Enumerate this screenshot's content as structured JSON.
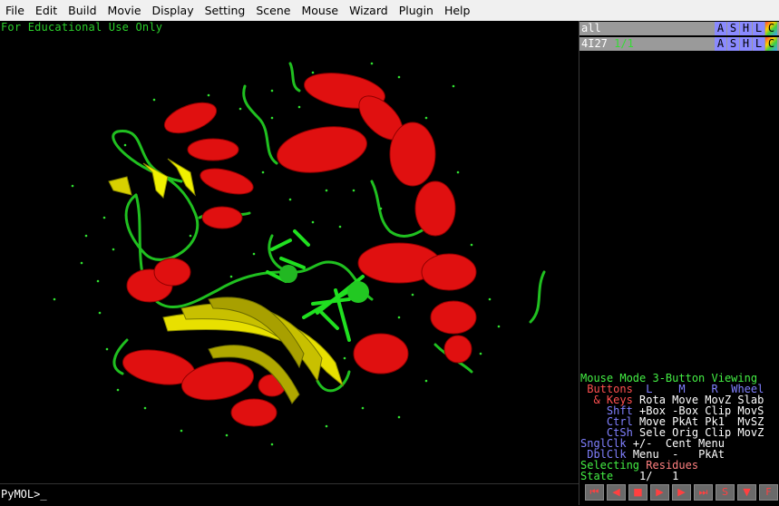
{
  "menu": [
    "File",
    "Edit",
    "Build",
    "Movie",
    "Display",
    "Setting",
    "Scene",
    "Mouse",
    "Wizard",
    "Plugin",
    "Help"
  ],
  "viewer": {
    "watermark": "For Educational Use Only"
  },
  "objects": [
    {
      "name": "all",
      "state": "",
      "buttons": [
        "A",
        "S",
        "H",
        "L",
        "C"
      ]
    },
    {
      "name": "4I27",
      "state": "1/1",
      "buttons": [
        "A",
        "S",
        "H",
        "L",
        "C"
      ]
    }
  ],
  "mouse": {
    "mode_label": "Mouse Mode",
    "mode_value": "3-Button Viewing",
    "buttons_label": "Buttons",
    "col_l": "L",
    "col_m": "M",
    "col_r": "R",
    "col_wheel": "Wheel",
    "keys_label": "& Keys",
    "keys_row": "Rota Move MovZ Slab",
    "shft_label": "Shft",
    "shft_row": "+Box -Box Clip MovS",
    "ctrl_label": "Ctrl",
    "ctrl_row": "Move PkAt Pk1  MvSZ",
    "ctsh_label": "CtSh",
    "ctsh_row": "Sele Orig Clip MovZ",
    "snglclk_label": "SnglClk",
    "snglclk_row": "+/-  Cent Menu",
    "dblclk_label": "DblClk",
    "dblclk_row": "Menu  -   PkAt",
    "selecting_label": "Selecting",
    "selecting_value": "Residues",
    "state_label": "State",
    "state_value": "1/   1"
  },
  "command": {
    "prompt": "PyMOL>_"
  },
  "movie_controls": [
    "rewind-icon",
    "step-back-icon",
    "stop-icon",
    "play-icon",
    "step-forward-icon",
    "end-icon",
    "S",
    "menu-down-icon",
    "F"
  ],
  "colors": {
    "helix": "#e01010",
    "sheet": "#e8e000",
    "loop": "#20c020",
    "text_green": "#2bd02b"
  }
}
